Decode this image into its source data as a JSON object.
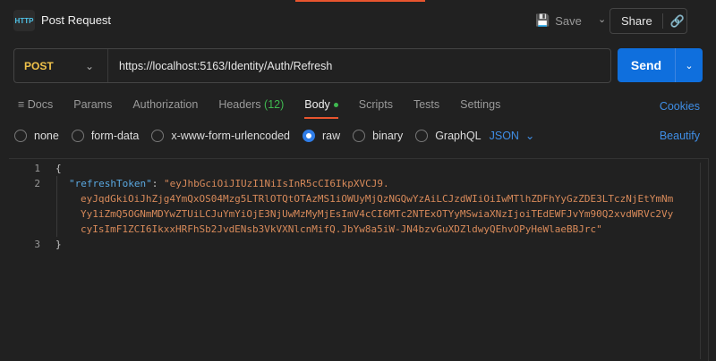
{
  "header": {
    "title": "Post Request",
    "logo_text": "HTTP",
    "save_label": "Save",
    "share_label": "Share"
  },
  "request": {
    "method": "POST",
    "url": "https://localhost:5163/Identity/Auth/Refresh",
    "send_label": "Send"
  },
  "tabs": [
    {
      "label": "Docs"
    },
    {
      "label": "Params"
    },
    {
      "label": "Authorization"
    },
    {
      "label": "Headers",
      "count": "(12)"
    },
    {
      "label": "Body",
      "active": true
    },
    {
      "label": "Scripts"
    },
    {
      "label": "Tests"
    },
    {
      "label": "Settings"
    }
  ],
  "cookies_label": "Cookies",
  "body_options": [
    {
      "label": "none"
    },
    {
      "label": "form-data"
    },
    {
      "label": "x-www-form-urlencoded"
    },
    {
      "label": "raw",
      "selected": true
    },
    {
      "label": "binary"
    },
    {
      "label": "GraphQL"
    }
  ],
  "format": "JSON",
  "beautify_label": "Beautify",
  "editor": {
    "line_numbers": [
      "1",
      "2",
      "3"
    ],
    "open_brace": "{",
    "close_brace": "}",
    "key": "\"refreshToken\"",
    "colon": ": ",
    "value_lines": [
      "\"eyJhbGciOiJIUzI1NiIsInR5cCI6IkpXVCJ9.",
      "eyJqdGkiOiJhZjg4YmQxOS04Mzg5LTRlOTQtOTAzMS1iOWUyMjQzNGQwYzAiLCJzdWIiOiIwMTlhZDFhYyGzZDE3LTczNjEtYmNm",
      "Yy1iZmQ5OGNmMDYwZTUiLCJuYmYiOjE3NjUwMzMyMjEsImV4cCI6MTc2NTExOTYyMSwiaXNzIjoiTEdEWFJvYm90Q2xvdWRVc2Vy",
      "cyIsImF1ZCI6IkxxHRFhSb2JvdENsb3VkVXNlcnMifQ.JbYw8a5iW-JN4bzvGuXDZldwyQEhvOPyHeWlaeBBJrc\""
    ]
  },
  "colors": {
    "accent": "#e8552f",
    "primary": "#0f6fdd",
    "link": "#3f8ee6",
    "method": "#f0c24a"
  }
}
